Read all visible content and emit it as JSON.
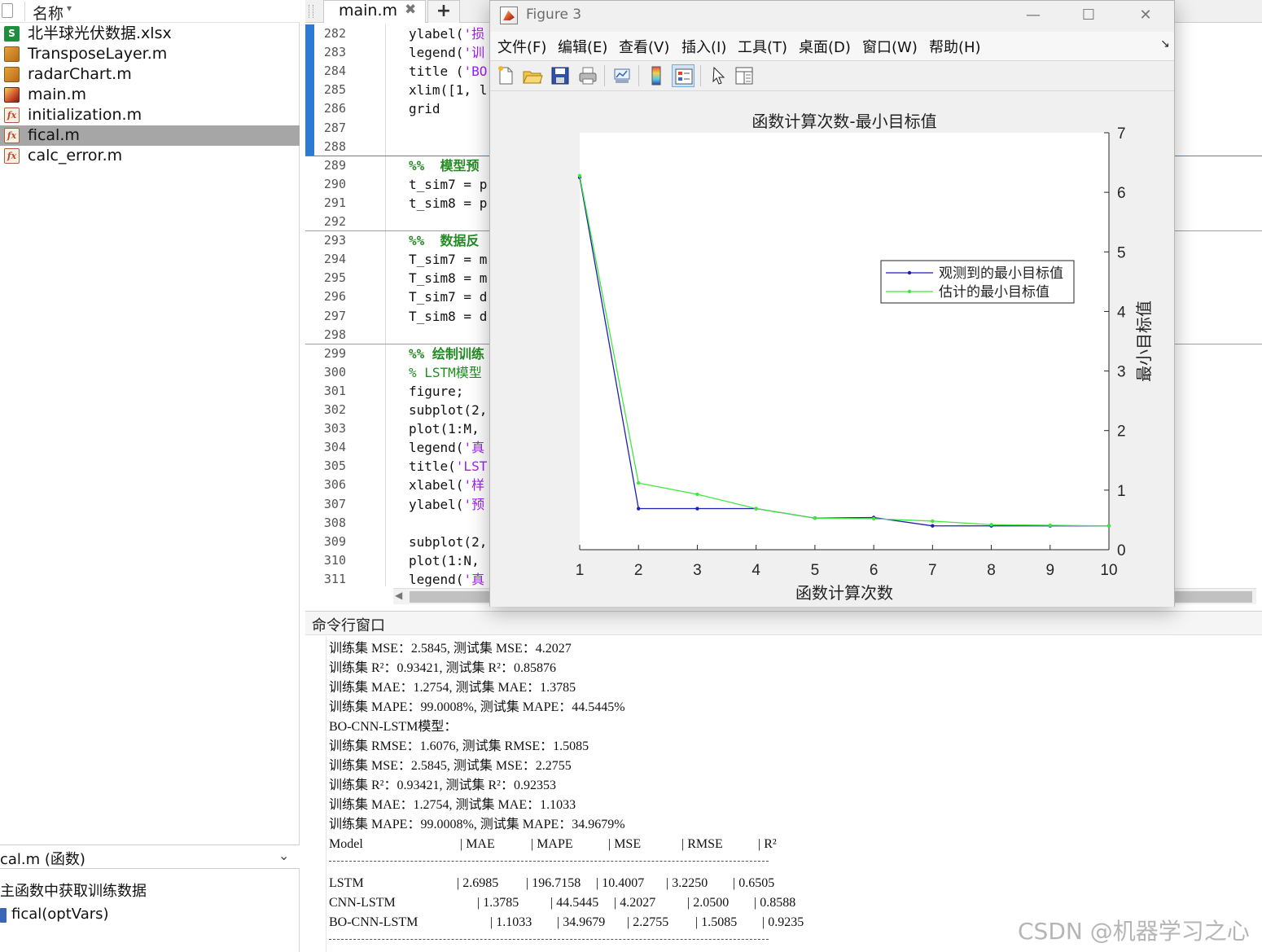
{
  "file_browser": {
    "column_header": "名称",
    "files": [
      {
        "name": "北半球光伏数据.xlsx",
        "icon": "xlsx-file-icon",
        "selected": false
      },
      {
        "name": "TransposeLayer.m",
        "icon": "class-file-icon",
        "selected": false
      },
      {
        "name": "radarChart.m",
        "icon": "class-file-icon",
        "selected": false
      },
      {
        "name": "main.m",
        "icon": "script-file-icon",
        "selected": false
      },
      {
        "name": "initialization.m",
        "icon": "function-file-icon",
        "selected": false
      },
      {
        "name": "fical.m",
        "icon": "function-file-icon",
        "selected": true
      },
      {
        "name": "calc_error.m",
        "icon": "function-file-icon",
        "selected": false
      }
    ],
    "details_title": "cal.m (函数)",
    "details_description": "主函数中获取训练数据",
    "details_signature": "fical(optVars)"
  },
  "editor": {
    "tab_label": "main.m",
    "tab_close": "✖",
    "tab_add": "+",
    "lines": [
      {
        "n": "282",
        "parts": [
          [
            "t",
            "ylabel("
          ],
          [
            "s",
            "'损"
          ]
        ]
      },
      {
        "n": "283",
        "parts": [
          [
            "t",
            "legend("
          ],
          [
            "s",
            "'训"
          ]
        ]
      },
      {
        "n": "284",
        "parts": [
          [
            "t",
            "title ("
          ],
          [
            "s",
            "'BO"
          ]
        ]
      },
      {
        "n": "285",
        "parts": [
          [
            "t",
            "xlim([1, l"
          ]
        ]
      },
      {
        "n": "286",
        "parts": [
          [
            "t",
            "grid"
          ]
        ]
      },
      {
        "n": "287",
        "parts": []
      },
      {
        "n": "288",
        "parts": []
      },
      {
        "n": "289",
        "parts": [
          [
            "cb",
            "%%  模型预"
          ]
        ]
      },
      {
        "n": "290",
        "parts": [
          [
            "t",
            "t_sim7 = p"
          ]
        ]
      },
      {
        "n": "291",
        "parts": [
          [
            "t",
            "t_sim8 = p"
          ]
        ]
      },
      {
        "n": "292",
        "parts": []
      },
      {
        "n": "293",
        "parts": [
          [
            "cb",
            "%%  数据反"
          ]
        ]
      },
      {
        "n": "294",
        "parts": [
          [
            "t",
            "T_sim7 = m"
          ]
        ]
      },
      {
        "n": "295",
        "parts": [
          [
            "t",
            "T_sim8 = m"
          ]
        ]
      },
      {
        "n": "296",
        "parts": [
          [
            "t",
            "T_sim7 = d"
          ]
        ]
      },
      {
        "n": "297",
        "parts": [
          [
            "t",
            "T_sim8 = d"
          ]
        ]
      },
      {
        "n": "298",
        "parts": []
      },
      {
        "n": "299",
        "parts": [
          [
            "cb",
            "%% 绘制训练"
          ]
        ]
      },
      {
        "n": "300",
        "parts": [
          [
            "c",
            "% LSTM模型"
          ]
        ]
      },
      {
        "n": "301",
        "parts": [
          [
            "t",
            "figure;"
          ]
        ]
      },
      {
        "n": "302",
        "parts": [
          [
            "t",
            "subplot(2,"
          ]
        ]
      },
      {
        "n": "303",
        "parts": [
          [
            "t",
            "plot(1:M, "
          ]
        ]
      },
      {
        "n": "304",
        "parts": [
          [
            "t",
            "legend("
          ],
          [
            "s",
            "'真"
          ]
        ]
      },
      {
        "n": "305",
        "parts": [
          [
            "t",
            "title("
          ],
          [
            "s",
            "'LST"
          ]
        ]
      },
      {
        "n": "306",
        "parts": [
          [
            "t",
            "xlabel("
          ],
          [
            "s",
            "'样"
          ]
        ]
      },
      {
        "n": "307",
        "parts": [
          [
            "t",
            "ylabel("
          ],
          [
            "s",
            "'预"
          ]
        ]
      },
      {
        "n": "308",
        "parts": []
      },
      {
        "n": "309",
        "parts": [
          [
            "t",
            "subplot(2,"
          ]
        ]
      },
      {
        "n": "310",
        "parts": [
          [
            "t",
            "plot(1:N, "
          ]
        ]
      },
      {
        "n": "311",
        "parts": [
          [
            "t",
            "legend("
          ],
          [
            "s",
            "'真"
          ]
        ]
      }
    ]
  },
  "command_window": {
    "title": "命令行窗口",
    "lines": [
      "训练集 MSE：2.5845, 测试集 MSE：4.2027",
      "训练集 R²：0.93421, 测试集 R²：0.85876",
      "训练集 MAE：1.2754, 测试集 MAE：1.3785",
      "训练集 MAPE：99.0008%, 测试集 MAPE：44.5445%",
      "BO-CNN-LSTM模型：",
      "训练集 RMSE：1.6076, 测试集 RMSE：1.5085",
      "训练集 MSE：2.5845, 测试集 MSE：2.2755",
      "训练集 R²：0.93421, 测试集 R²：0.92353",
      "训练集 MAE：1.2754, 测试集 MAE：1.1033",
      "训练集 MAPE：99.0008%, 测试集 MAPE：34.9679%"
    ],
    "table_header": [
      "Model",
      "| MAE",
      "| MAPE",
      "| MSE",
      "| RMSE",
      "| R²"
    ],
    "table_rows": [
      [
        "LSTM",
        "| 2.6985",
        "| 196.7158",
        "| 10.4007",
        "| 3.2250",
        "| 0.6505"
      ],
      [
        "CNN-LSTM",
        "| 1.3785",
        "| 44.5445",
        "| 4.2027",
        "| 2.0500",
        "| 0.8588"
      ],
      [
        "BO-CNN-LSTM",
        "| 1.1033",
        "| 34.9679",
        "| 2.2755",
        "| 1.5085",
        "| 0.9235"
      ]
    ]
  },
  "figure": {
    "window_title": "Figure 3",
    "minimize": "—",
    "maximize": "☐",
    "close": "✕",
    "menus": [
      "文件(F)",
      "编辑(E)",
      "查看(V)",
      "插入(I)",
      "工具(T)",
      "桌面(D)",
      "窗口(W)",
      "帮助(H)"
    ],
    "dock_glyph": "↘",
    "toolbar_icons": [
      "new-figure-icon",
      "open-file-icon",
      "save-icon",
      "print-icon",
      "link-plot-icon",
      "colorbar-icon",
      "legend-icon",
      "pointer-icon",
      "property-editor-icon"
    ]
  },
  "chart_data": {
    "type": "line",
    "title": "函数计算次数-最小目标值",
    "xlabel": "函数计算次数",
    "ylabel": "最小目标值",
    "x": [
      1,
      2,
      3,
      4,
      5,
      6,
      7,
      8,
      9,
      10
    ],
    "xlim": [
      1,
      10
    ],
    "ylim": [
      0,
      7
    ],
    "xticks": [
      "1",
      "2",
      "3",
      "4",
      "5",
      "6",
      "7",
      "8",
      "9",
      "10"
    ],
    "yticks": [
      "0",
      "1",
      "2",
      "3",
      "4",
      "5",
      "6",
      "7"
    ],
    "y_axis_side": "right",
    "grid": false,
    "legend_position": "upper-right inside",
    "series": [
      {
        "name": "观测到的最小目标值",
        "color": "#1f1fb0",
        "values": [
          6.25,
          0.69,
          0.69,
          0.69,
          0.53,
          0.54,
          0.4,
          0.4,
          0.4,
          0.4
        ]
      },
      {
        "name": "估计的最小目标值",
        "color": "#3ee83e",
        "values": [
          6.28,
          1.12,
          0.93,
          0.69,
          0.53,
          0.52,
          0.48,
          0.42,
          0.41,
          0.4
        ]
      }
    ]
  },
  "watermark": "CSDN @机器学习之心"
}
